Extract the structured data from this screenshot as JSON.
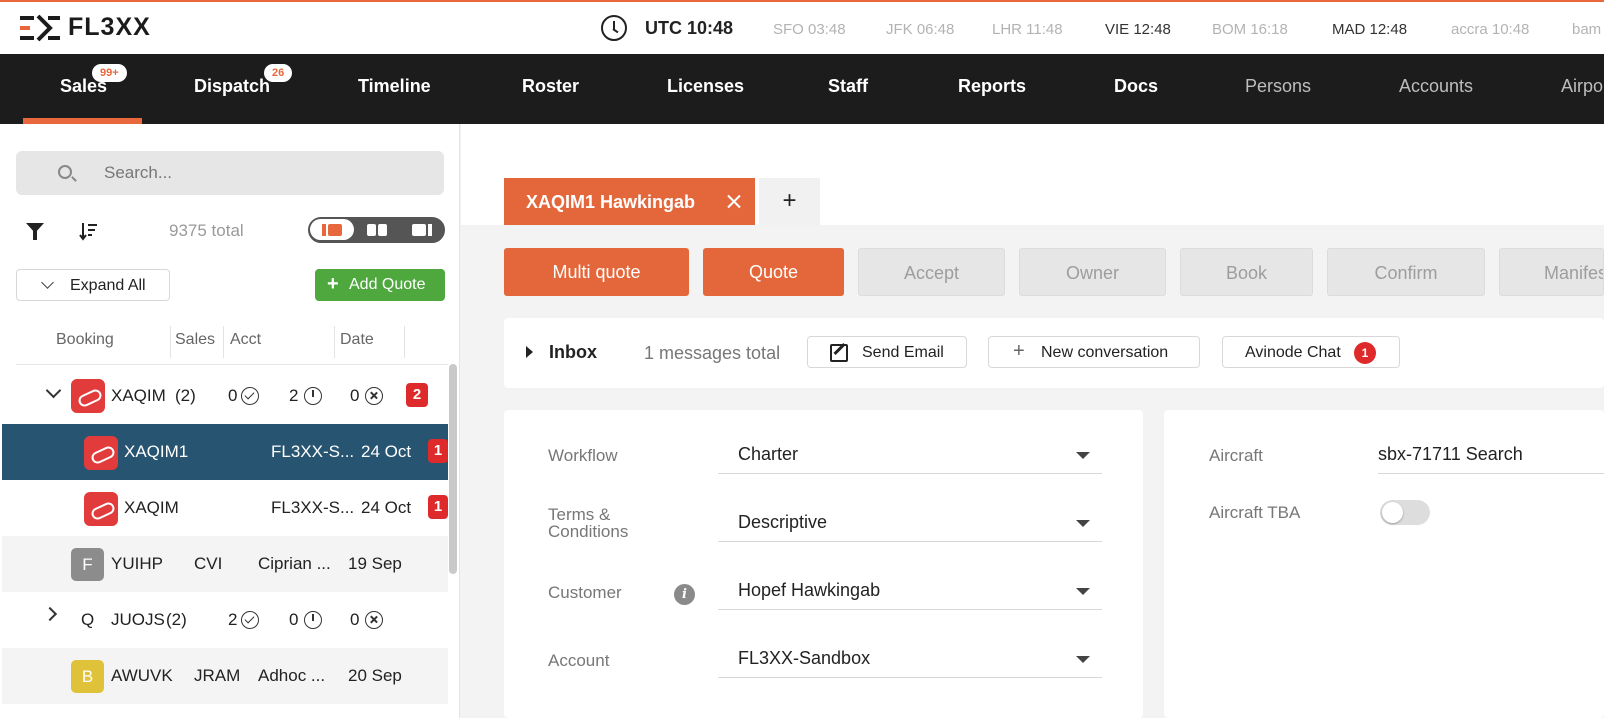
{
  "brand": {
    "logo_text": "FL3XX"
  },
  "clock": {
    "utc": "UTC 10:48",
    "zones": [
      {
        "label": "SFO 03:48",
        "highlight": false
      },
      {
        "label": "JFK 06:48",
        "highlight": false
      },
      {
        "label": "LHR 11:48",
        "highlight": false
      },
      {
        "label": "VIE 12:48",
        "highlight": true
      },
      {
        "label": "BOM 16:18",
        "highlight": false
      },
      {
        "label": "MAD 12:48",
        "highlight": true
      },
      {
        "label": "accra 10:48",
        "highlight": false
      },
      {
        "label": "bam",
        "highlight": false
      }
    ]
  },
  "nav": {
    "items": [
      {
        "label": "Sales",
        "badge": "99+",
        "active": true
      },
      {
        "label": "Dispatch",
        "badge": "26"
      },
      {
        "label": "Timeline"
      },
      {
        "label": "Roster"
      },
      {
        "label": "Licenses"
      },
      {
        "label": "Staff"
      },
      {
        "label": "Reports"
      },
      {
        "label": "Docs"
      },
      {
        "label": "Persons",
        "dim": true
      },
      {
        "label": "Accounts",
        "dim": true
      },
      {
        "label": "Airpo",
        "dim": true
      }
    ],
    "accent": "#e8673c"
  },
  "sidebar": {
    "search_placeholder": "Search...",
    "total": "9375 total",
    "expand_all": "Expand All",
    "add_quote": "Add Quote",
    "columns": [
      "Booking",
      "Sales",
      "Acct",
      "Date"
    ],
    "rows": [
      {
        "type": "group",
        "expanded": true,
        "icon": "plane",
        "booking": "XAQIM",
        "count_label": "(2)",
        "c1": "0",
        "c2": "2",
        "c3": "0",
        "badge": "2"
      },
      {
        "type": "child",
        "selected": true,
        "icon": "plane",
        "booking": "XAQIM1",
        "acct": "FL3XX-S...",
        "date": "24 Oct",
        "badge": "1"
      },
      {
        "type": "child",
        "icon": "plane",
        "booking": "XAQIM",
        "acct": "FL3XX-S...",
        "date": "24 Oct",
        "badge": "1"
      },
      {
        "type": "single",
        "letter": "F",
        "letter_color": "#8c8c8c",
        "booking": "YUIHP",
        "sales": "CVI",
        "acct": "Ciprian ...",
        "date": "19 Sep"
      },
      {
        "type": "group",
        "expanded": false,
        "letter": "Q",
        "booking": "JUOJS",
        "count_label": "(2)",
        "c1": "2",
        "c2": "0",
        "c3": "0"
      },
      {
        "type": "single",
        "letter": "B",
        "letter_color": "#e0c23a",
        "booking": "AWUVK",
        "sales": "JRAM",
        "acct": "Adhoc ...",
        "date": "20 Sep"
      }
    ]
  },
  "tabs": {
    "active_label": "XAQIM1 Hawkingab",
    "add_label": "+"
  },
  "actions": [
    {
      "label": "Multi quote",
      "state": "primary"
    },
    {
      "label": "Quote",
      "state": "primary"
    },
    {
      "label": "Accept",
      "state": "disabled"
    },
    {
      "label": "Owner",
      "state": "disabled"
    },
    {
      "label": "Book",
      "state": "disabled"
    },
    {
      "label": "Confirm",
      "state": "disabled"
    },
    {
      "label": "Manifes",
      "state": "disabled"
    }
  ],
  "inbox": {
    "title": "Inbox",
    "count": "1 messages total",
    "send_email": "Send Email",
    "new_conversation": "New conversation",
    "avinode_chat": "Avinode Chat",
    "avinode_badge": "1"
  },
  "form": {
    "workflow_label": "Workflow",
    "workflow_value": "Charter",
    "terms_label_1": "Terms &",
    "terms_label_2": "Conditions",
    "terms_value": "Descriptive",
    "customer_label": "Customer",
    "customer_value": "Hopef Hawkingab",
    "account_label": "Account",
    "account_value": "FL3XX-Sandbox",
    "aircraft_label": "Aircraft",
    "aircraft_value": "sbx-71711 Search",
    "aircraft_tba_label": "Aircraft TBA",
    "aircraft_tba_on": false
  }
}
